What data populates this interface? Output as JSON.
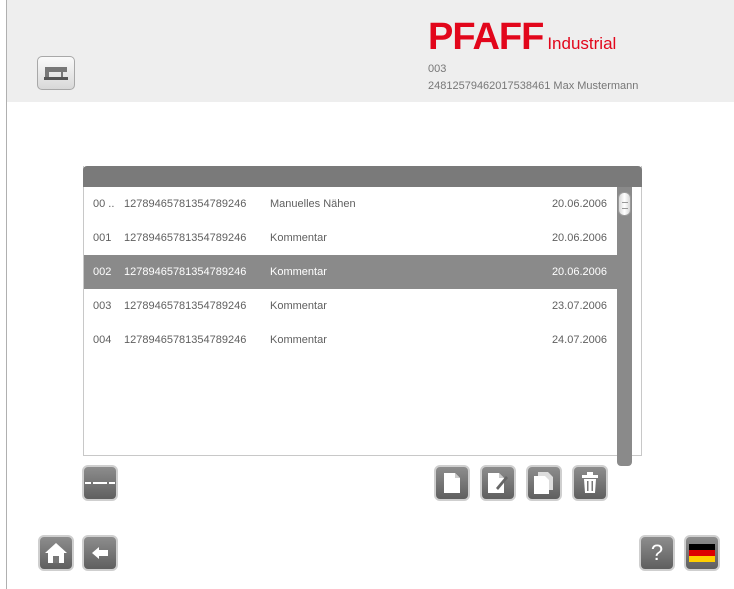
{
  "header": {
    "brand": "PFAFF",
    "brand_suffix": "Industrial",
    "code": "003",
    "user_line": "24812579462017538461   Max Mustermann"
  },
  "list": {
    "rows": [
      {
        "no": "00 ..",
        "id": "12789465781354789246",
        "comment": "Manuelles Nähen",
        "date": "20.06.2006",
        "selected": false
      },
      {
        "no": "001",
        "id": "12789465781354789246",
        "comment": "Kommentar",
        "date": "20.06.2006",
        "selected": false
      },
      {
        "no": "002",
        "id": "12789465781354789246",
        "comment": "Kommentar",
        "date": "20.06.2006",
        "selected": true
      },
      {
        "no": "003",
        "id": "12789465781354789246",
        "comment": "Kommentar",
        "date": "23.07.2006",
        "selected": false
      },
      {
        "no": "004",
        "id": "12789465781354789246",
        "comment": "Kommentar",
        "date": "24.07.2006",
        "selected": false
      }
    ]
  },
  "footer": {
    "help_label": "?"
  },
  "colors": {
    "brand": "#e2061b",
    "header_bg": "#eeeeee",
    "button_gray": "#6e6e6e",
    "selected_row": "#8a8a8a"
  },
  "icons": [
    "sewing-machine-icon",
    "dashed-line-icon",
    "new-document-icon",
    "edit-document-icon",
    "copy-document-icon",
    "trash-icon",
    "home-icon",
    "arrow-left-icon",
    "german-flag-icon"
  ]
}
